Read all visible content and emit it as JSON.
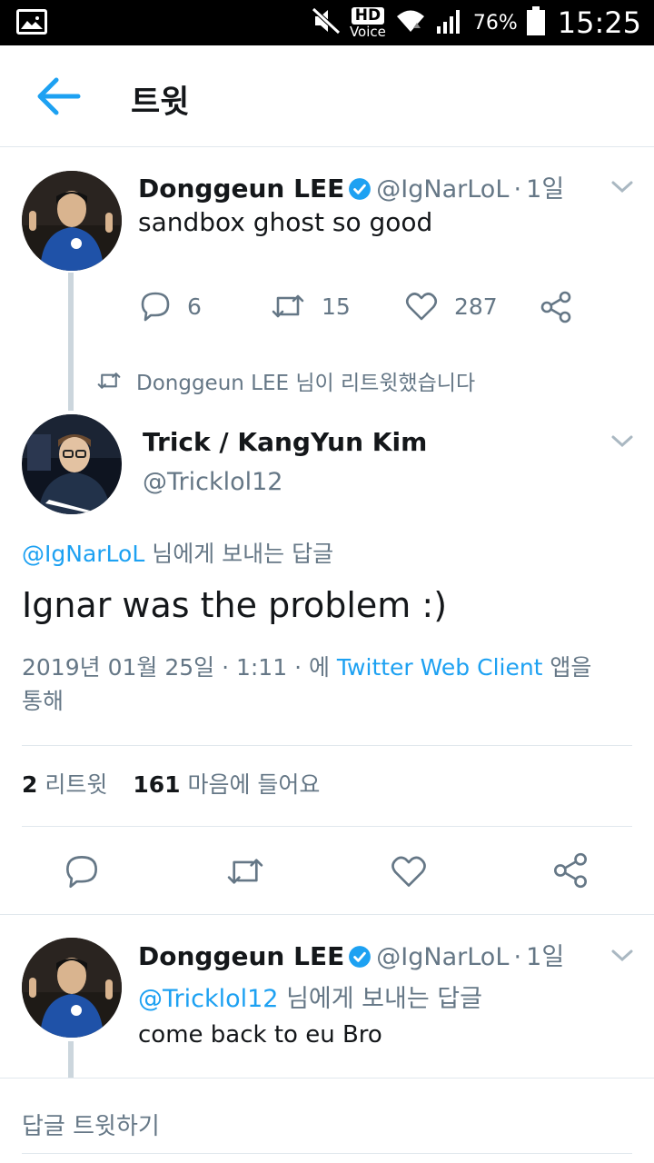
{
  "status_bar": {
    "hd": "HD",
    "voice": "Voice",
    "battery": "76%",
    "time": "15:25"
  },
  "header": {
    "title": "트윗"
  },
  "tweet1": {
    "name": "Donggeun LEE",
    "handle": "@IgNarLoL",
    "dot": "·",
    "time": "1일",
    "text": "sandbox ghost so good",
    "replies": "6",
    "retweets": "15",
    "likes": "287"
  },
  "retweet_notice": "Donggeun LEE 님이 리트윗했습니다",
  "main_tweet": {
    "name": "Trick / KangYun Kim",
    "handle": "@Tricklol12",
    "reply_to_handle": "@IgNarLoL",
    "reply_to_suffix": " 님에게 보내는 답글",
    "text": "Ignar was the problem :)",
    "meta_prefix": "2019년 01월 25일 · 1:11 · 에 ",
    "meta_client": "Twitter Web Client",
    "meta_suffix": " 앱을",
    "meta_line2": "통해",
    "retweet_count": "2",
    "retweet_label": "리트윗",
    "like_count": "161",
    "like_label": "마음에 들어요"
  },
  "tweet3": {
    "name": "Donggeun LEE",
    "handle": "@IgNarLoL",
    "dot": "·",
    "time": "1일",
    "reply_to_handle": "@Tricklol12",
    "reply_to_suffix": " 님에게 보내는 답글",
    "text": "come back to eu Bro"
  },
  "compose": {
    "placeholder": "답글 트윗하기"
  },
  "colors": {
    "accent": "#1da1f2",
    "muted": "#657786",
    "divider": "#e1e8ed"
  }
}
